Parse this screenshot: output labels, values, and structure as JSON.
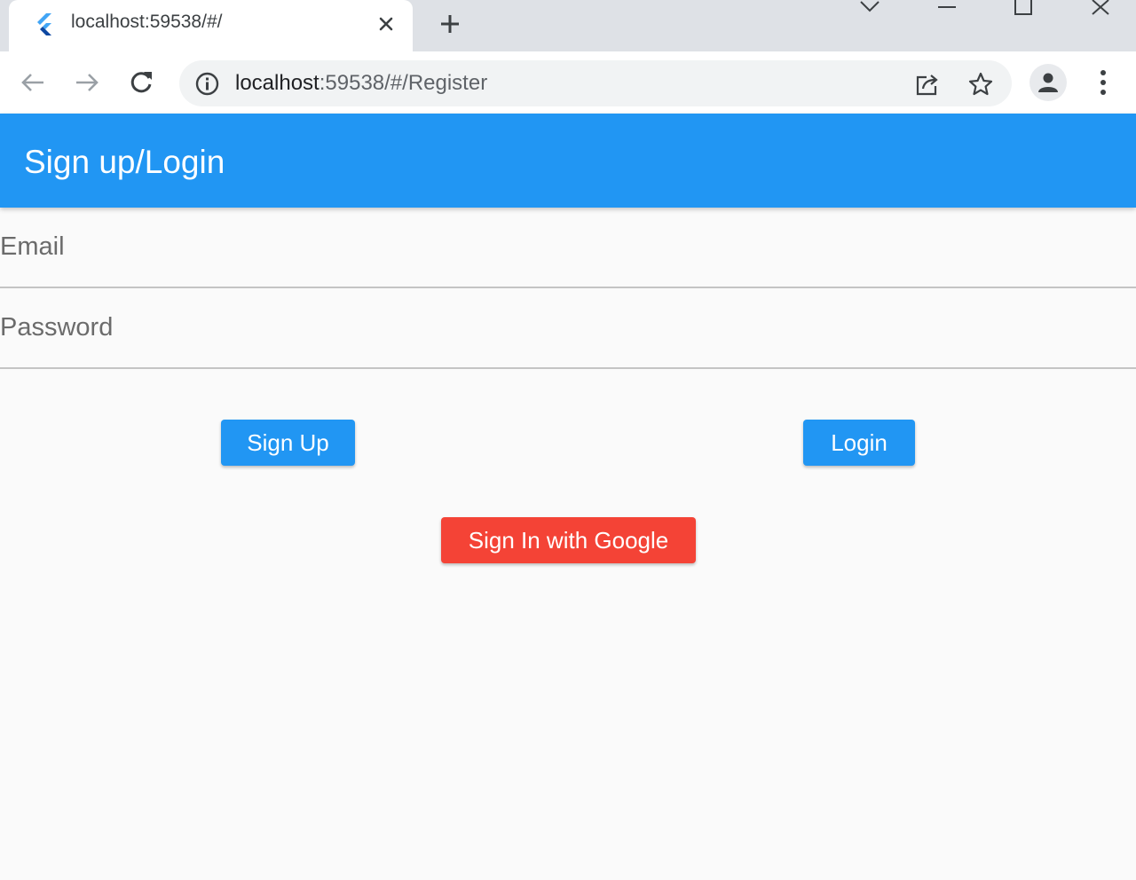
{
  "browser": {
    "tab": {
      "title": "localhost:59538/#/",
      "favicon": "flutter-icon"
    },
    "new_tab_icon": "plus-icon",
    "window_controls": [
      "chevron-down-icon",
      "minimize-icon",
      "maximize-icon",
      "close-icon"
    ],
    "toolbar": {
      "back_icon": "arrow-left-icon",
      "forward_icon": "arrow-right-icon",
      "reload_icon": "reload-icon",
      "url_host": "localhost",
      "url_path": ":59538/#/Register",
      "share_icon": "share-icon",
      "bookmark_icon": "star-icon",
      "profile_icon": "person-icon",
      "menu_icon": "kebab-menu-icon"
    }
  },
  "app": {
    "appbar_title": "Sign up/Login",
    "appbar_color": "#2196f3",
    "email": {
      "placeholder": "Email",
      "value": ""
    },
    "password": {
      "placeholder": "Password",
      "value": ""
    },
    "signup_label": "Sign Up",
    "login_label": "Login",
    "google_label": "Sign In with Google",
    "google_color": "#f44336"
  }
}
